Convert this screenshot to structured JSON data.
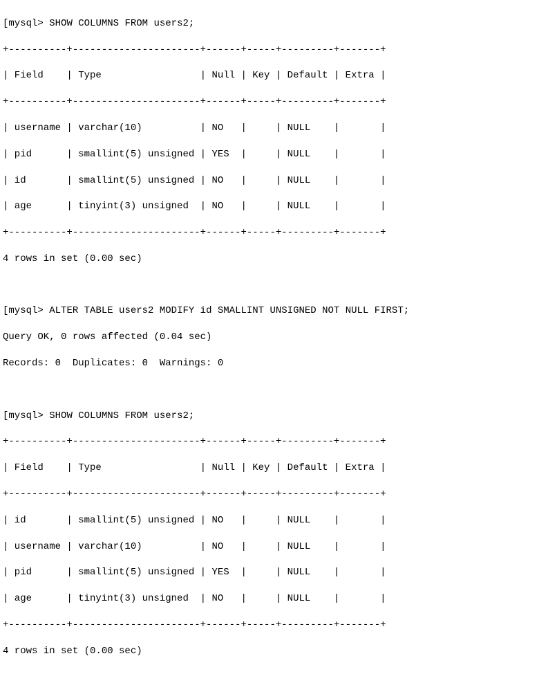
{
  "chart_data": {
    "type": "table",
    "tables": [
      {
        "title": "SHOW COLUMNS FROM users2 (before)",
        "columns": [
          "Field",
          "Type",
          "Null",
          "Key",
          "Default",
          "Extra"
        ],
        "rows": [
          [
            "username",
            "varchar(10)",
            "NO",
            "",
            "NULL",
            ""
          ],
          [
            "pid",
            "smallint(5) unsigned",
            "YES",
            "",
            "NULL",
            ""
          ],
          [
            "id",
            "smallint(5) unsigned",
            "NO",
            "",
            "NULL",
            ""
          ],
          [
            "age",
            "tinyint(3) unsigned",
            "NO",
            "",
            "NULL",
            ""
          ]
        ]
      },
      {
        "title": "SHOW COLUMNS FROM users2 (after)",
        "columns": [
          "Field",
          "Type",
          "Null",
          "Key",
          "Default",
          "Extra"
        ],
        "rows": [
          [
            "id",
            "smallint(5) unsigned",
            "NO",
            "",
            "NULL",
            ""
          ],
          [
            "username",
            "varchar(10)",
            "NO",
            "",
            "NULL",
            ""
          ],
          [
            "pid",
            "smallint(5) unsigned",
            "YES",
            "",
            "NULL",
            ""
          ],
          [
            "age",
            "tinyint(3) unsigned",
            "NO",
            "",
            "NULL",
            ""
          ]
        ]
      }
    ]
  },
  "prompts": {
    "p1": {
      "bracket": "[",
      "prompt": "mysql>",
      "command": "SHOW COLUMNS FROM users2;"
    },
    "p2": {
      "bracket": "[",
      "prompt": "mysql>",
      "command": "ALTER TABLE users2 MODIFY id SMALLINT UNSIGNED NOT NULL FIRST;",
      "result1": "Query OK, 0 rows affected (0.04 sec)",
      "result2": "Records: 0  Duplicates: 0  Warnings: 0"
    },
    "p3": {
      "bracket": "[",
      "prompt": "mysql>",
      "command": "SHOW COLUMNS FROM users2;"
    }
  },
  "tables": {
    "t1": {
      "border": "+----------+----------------------+------+-----+---------+-------+",
      "header": "| Field    | Type                 | Null | Key | Default | Extra |",
      "rows": [
        "| username | varchar(10)          | NO   |     | NULL    |       |",
        "| pid      | smallint(5) unsigned | YES  |     | NULL    |       |",
        "| id       | smallint(5) unsigned | NO   |     | NULL    |       |",
        "| age      | tinyint(3) unsigned  | NO   |     | NULL    |       |"
      ],
      "summary": "4 rows in set (0.00 sec)"
    },
    "t2": {
      "border": "+----------+----------------------+------+-----+---------+-------+",
      "header": "| Field    | Type                 | Null | Key | Default | Extra |",
      "rows": [
        "| id       | smallint(5) unsigned | NO   |     | NULL    |       |",
        "| username | varchar(10)          | NO   |     | NULL    |       |",
        "| pid      | smallint(5) unsigned | YES  |     | NULL    |       |",
        "| age      | tinyint(3) unsigned  | NO   |     | NULL    |       |"
      ],
      "summary": "4 rows in set (0.00 sec)"
    }
  }
}
